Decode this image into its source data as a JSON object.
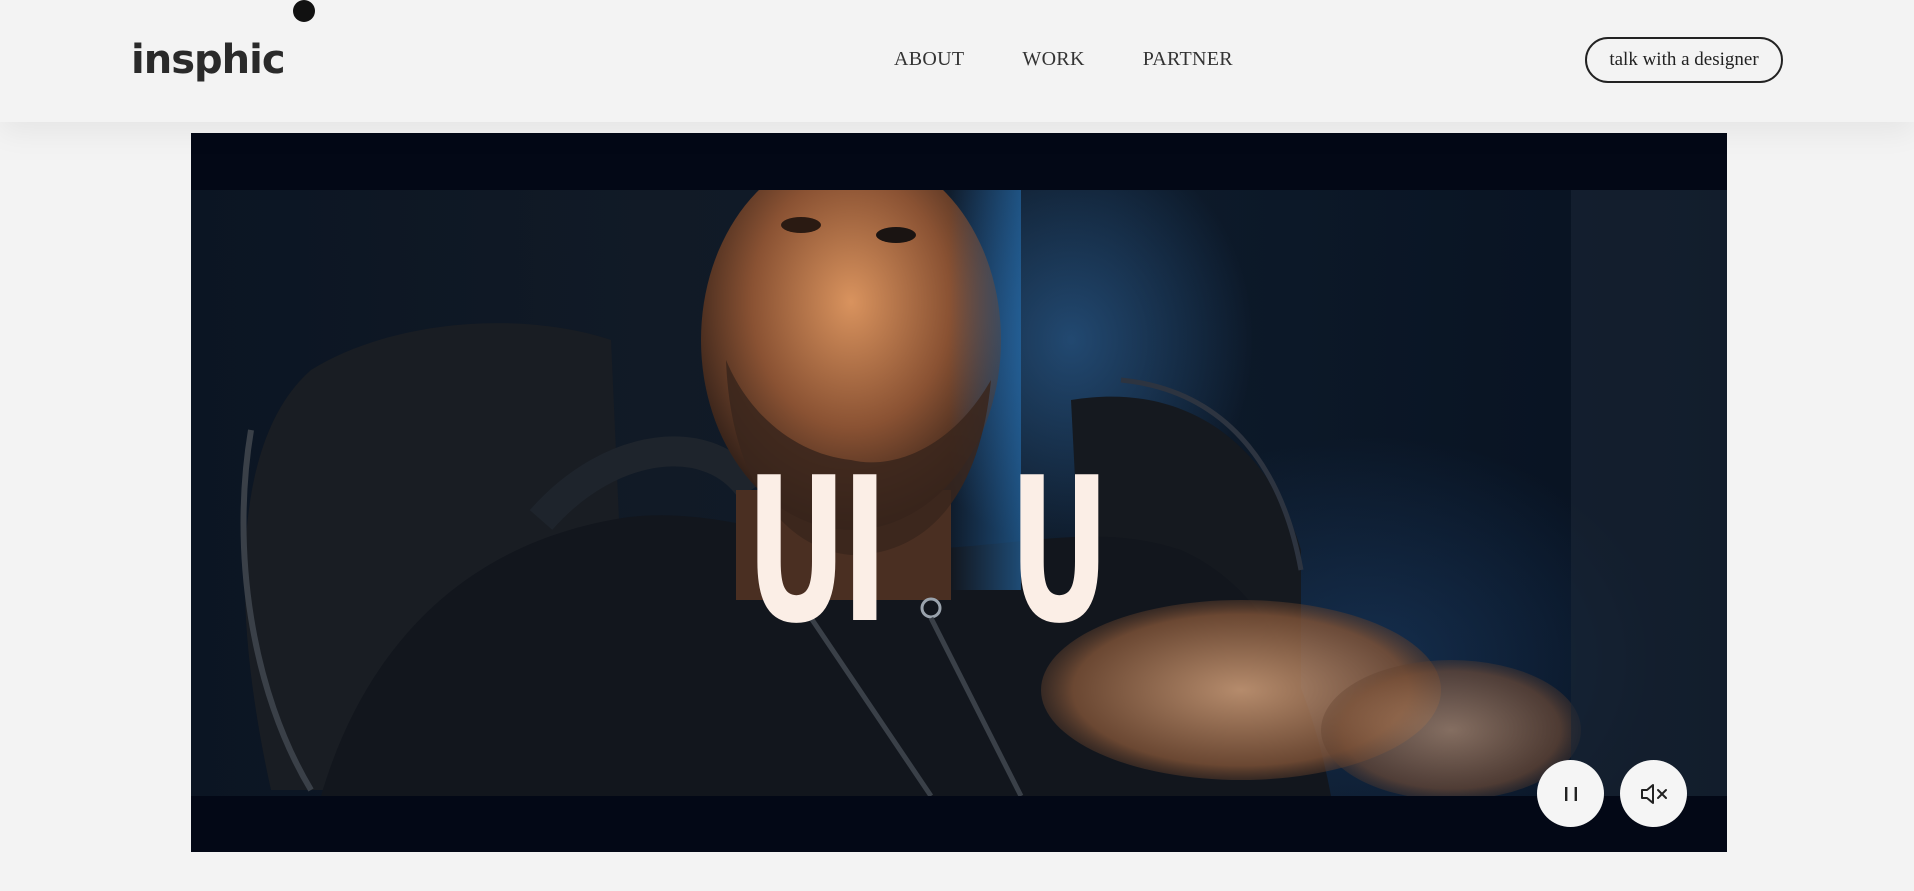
{
  "header": {
    "logo": {
      "text": "insphic"
    },
    "nav": [
      {
        "label": "ABOUT"
      },
      {
        "label": "WORK"
      },
      {
        "label": "PARTNER"
      }
    ],
    "cta_label": "talk with a designer"
  },
  "video": {
    "overlay_text": [
      "UI",
      "U"
    ],
    "controls": {
      "pause_icon": "pause-icon",
      "mute_icon": "volume-muted-icon"
    }
  },
  "colors": {
    "page_background": "#f3f3f3",
    "video_background": "#030816",
    "overlay_text": "#fbeee6",
    "control_background": "#f5f5f5"
  }
}
